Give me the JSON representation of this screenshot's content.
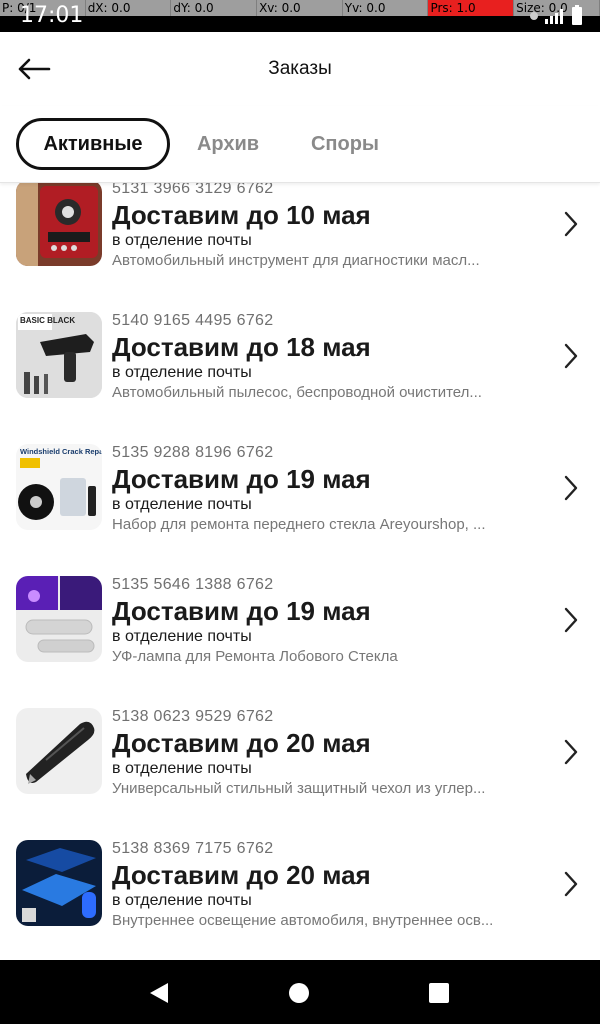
{
  "status_bar": {
    "time": "17:01",
    "debug": [
      "P: 0/1",
      "dX: 0.0",
      "dY: 0.0",
      "Xv: 0.0",
      "Yv: 0.0",
      "Prs: 1.0",
      "Size: 0.0"
    ]
  },
  "header": {
    "title": "Заказы"
  },
  "tabs": [
    {
      "label": "Активные",
      "active": true
    },
    {
      "label": "Архив",
      "active": false
    },
    {
      "label": "Споры",
      "active": false
    }
  ],
  "orders": [
    {
      "number": "5131 3966 3129 6762",
      "delivery": "Доставим до 10 мая",
      "place": "в отделение почты",
      "product": "Автомобильный инструмент для диагностики масл..."
    },
    {
      "number": "5140 9165 4495 6762",
      "delivery": "Доставим до 18 мая",
      "place": "в отделение почты",
      "product": "Автомобильный пылесос, беспроводной очистител...",
      "thumb_text": "BASIC BLACK"
    },
    {
      "number": "5135 9288 8196 6762",
      "delivery": "Доставим до 19 мая",
      "place": "в отделение почты",
      "product": "Набор для ремонта переднего стекла Areyourshop, ...",
      "thumb_text": "Windshield Crack Repair Kit"
    },
    {
      "number": "5135 5646 1388 6762",
      "delivery": "Доставим до 19 мая",
      "place": "в отделение почты",
      "product": "УФ-лампа для Ремонта Лобового Стекла"
    },
    {
      "number": "5138 0623 9529 6762",
      "delivery": "Доставим до 20 мая",
      "place": "в отделение почты",
      "product": "Универсальный стильный защитный чехол из углер..."
    },
    {
      "number": "5138 8369 7175 6762",
      "delivery": "Доставим до 20 мая",
      "place": "в отделение почты",
      "product": "Внутреннее освещение автомобиля, внутреннее осв..."
    }
  ],
  "icons": {
    "back": "arrow-left-icon",
    "chevron": "chevron-right-icon",
    "nav_back": "triangle-back-icon",
    "nav_home": "circle-home-icon",
    "nav_recents": "square-recents-icon"
  }
}
